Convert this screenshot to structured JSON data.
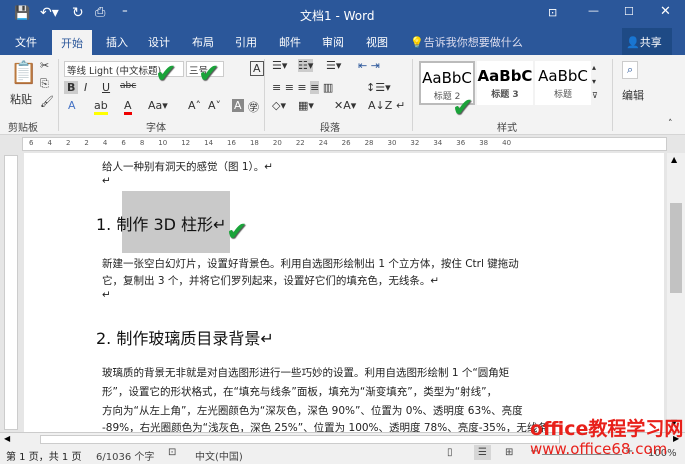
{
  "title": "文档1 - Word",
  "tabs": [
    "文件",
    "开始",
    "插入",
    "设计",
    "布局",
    "引用",
    "邮件",
    "审阅",
    "视图"
  ],
  "tellme": "告诉我你想要做什么",
  "share": "共享",
  "ribbon": {
    "paste": "粘贴",
    "clipboard": "剪贴板",
    "font_name": "等线 Light (中文标题)",
    "font_size": "三号",
    "font_group": "字体",
    "paragraph_group": "段落",
    "styles_group": "样式",
    "editing": "编辑",
    "styles": [
      {
        "sample": "AaBbC",
        "name": "标题 2"
      },
      {
        "sample": "AaBbC",
        "name": "标题 3"
      },
      {
        "sample": "AaBbC",
        "name": "标题"
      }
    ]
  },
  "ruler": [
    "6",
    "4",
    "2",
    "2",
    "4",
    "6",
    "8",
    "10",
    "12",
    "14",
    "16",
    "18",
    "20",
    "22",
    "24",
    "26",
    "28",
    "30",
    "32",
    "34",
    "36",
    "38",
    "40"
  ],
  "doc": {
    "line0": "给人一种别有洞天的感觉（图 1）。↵",
    "h1": "1. 制作 3D 柱形↵",
    "p1a": "新建一张空白幻灯片，设置好背景色。利用自选图形绘制出 1 个立方体，按住 Ctrl 键拖动",
    "p1b": "它，复制出 3 个，并将它们罗列起来，设置好它们的填充色，无线条。↵",
    "h2": "2. 制作玻璃质目录背景↵",
    "p2a": "玻璃质的背景无非就是对自选图形进行一些巧妙的设置。利用自选图形绘制 1 个“圆角矩",
    "p2b": "形”，设置它的形状格式，在“填充与线条”面板，填充为“渐变填充”，类型为“射线”，",
    "p2c": "方向为“从左上角”，左光圈颜色为“深灰色，深色 90%”、位置为 0%、透明度 63%、亮度",
    "p2d": "-89%，右光圈颜色为“浅灰色，深色 25%”、位置为 100%、透明度 78%、亮度-35%，无线条"
  },
  "status": {
    "page": "第 1 页，共 1 页",
    "words": "6/1036 个字",
    "lang": "中文(中国)",
    "zoom": "100%"
  },
  "watermark": {
    "line1": "office教程学习网",
    "line2": "www.office68.com"
  }
}
